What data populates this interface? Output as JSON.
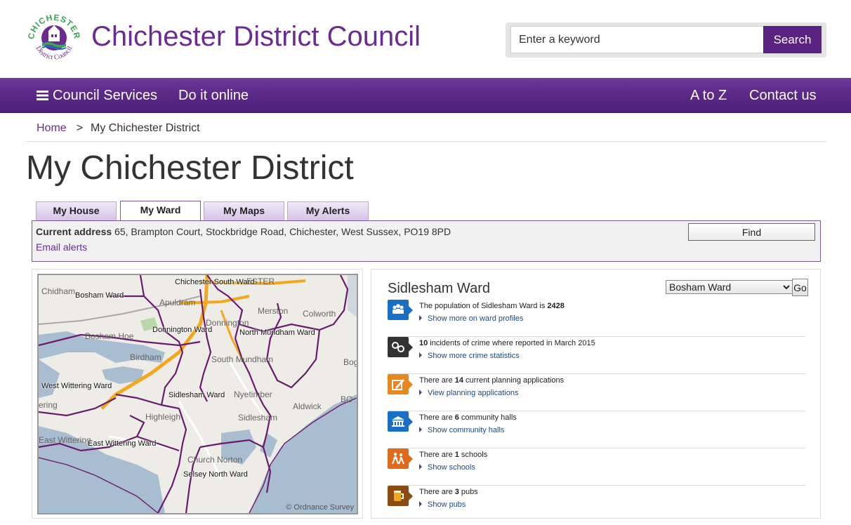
{
  "header": {
    "logo_text_top": "CHICHESTER",
    "logo_text_bottom": "District Council",
    "site_title": "Chichester District Council",
    "search_placeholder": "Enter a keyword",
    "search_button": "Search",
    "brand_color": "#6a2c91"
  },
  "nav": {
    "council_services": "Council Services",
    "do_it_online": "Do it online",
    "a_to_z": "A to Z",
    "contact_us": "Contact us"
  },
  "breadcrumb": {
    "home": "Home",
    "separator": ">",
    "current": "My Chichester District"
  },
  "page_title": "My Chichester District",
  "tabs": [
    {
      "label": "My House",
      "active": false
    },
    {
      "label": "My Ward",
      "active": true
    },
    {
      "label": "My Maps",
      "active": false
    },
    {
      "label": "My Alerts",
      "active": false
    }
  ],
  "address": {
    "label": "Current address",
    "value": "65, Brampton Court, Stockbridge Road, Chichester, West Sussex, PO19 8PD",
    "email_alerts": "Email alerts",
    "find_button": "Find"
  },
  "map": {
    "ward_labels": [
      "Chichester South Ward",
      "Bosham Ward",
      "Donnington Ward",
      "North Mundham Ward",
      "West Wittering Ward",
      "Sidlesham Ward",
      "East Wittering Ward",
      "Selsey North Ward"
    ],
    "place_labels": [
      "Chidham",
      "Apuldram",
      "Merston",
      "Colworth",
      "Donnington",
      "Bosham Hoe",
      "Birdham",
      "South Mundham",
      "Bog",
      "Nyetimber",
      "Aldwick",
      "BO",
      "Highleigh",
      "Sidlesham",
      "ering",
      "East Wittering",
      "Church Norton",
      "ESTER"
    ],
    "copyright": "© Ordnance Survey"
  },
  "ward": {
    "title": "Sidlesham Ward",
    "select_value": "Bosham Ward",
    "go_button": "Go",
    "stats": [
      {
        "icon": "population-icon",
        "color": "#1a6fc4",
        "prefix": "The population of Sidlesham Ward is ",
        "value": "2428",
        "suffix": "",
        "link": "Show more on ward profiles"
      },
      {
        "icon": "crime-icon",
        "color": "#333333",
        "prefix": "",
        "value": "10",
        "suffix": " incidents of crime where reported in March 2015",
        "link": "Show more crime statistics"
      },
      {
        "icon": "planning-icon",
        "color": "#e8871e",
        "prefix": "There are ",
        "value": "14",
        "suffix": " current planning applications",
        "link": "View planning applications"
      },
      {
        "icon": "community-hall-icon",
        "color": "#1a6fc4",
        "prefix": "There are ",
        "value": "6",
        "suffix": " community halls",
        "link": "Show community halls"
      },
      {
        "icon": "school-icon",
        "color": "#e06a1a",
        "prefix": "There are ",
        "value": "1",
        "suffix": " schools",
        "link": "Show schools"
      },
      {
        "icon": "pub-icon",
        "color": "#8a4a12",
        "prefix": "There are ",
        "value": "3",
        "suffix": " pubs",
        "link": "Show pubs"
      }
    ]
  }
}
